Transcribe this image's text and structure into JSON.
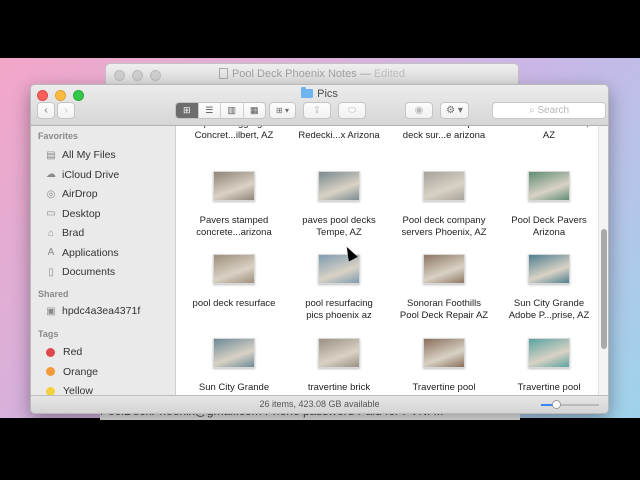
{
  "background_window": {
    "title": "Pool Deck Phoenix Notes",
    "status": "Edited",
    "bottom_text": "PoolDeckPhoenix@gmail.com Phone password Paid for PVNP..."
  },
  "window": {
    "title": "Pics",
    "search_placeholder": "Search",
    "status_text": "26 items, 423.08 GB available",
    "icon_size_level": 0.25
  },
  "toolbar": {
    "back": "‹",
    "forward": "›",
    "view_modes": [
      "⊞",
      "☰",
      "▥",
      "▦"
    ],
    "arrange": "⊞ ▾",
    "share": "⇪",
    "tag": "⬭",
    "quick_look": "◉",
    "action": "⚙ ▾"
  },
  "sidebar": {
    "favorites_header": "Favorites",
    "favorites": [
      {
        "label": "All My Files",
        "icon": "all-files-icon",
        "glyph": "▤"
      },
      {
        "label": "iCloud Drive",
        "icon": "cloud-icon",
        "glyph": "☁"
      },
      {
        "label": "AirDrop",
        "icon": "airdrop-icon",
        "glyph": "◎"
      },
      {
        "label": "Desktop",
        "icon": "desktop-icon",
        "glyph": "▭"
      },
      {
        "label": "Brad",
        "icon": "home-icon",
        "glyph": "⌂"
      },
      {
        "label": "Applications",
        "icon": "applications-icon",
        "glyph": "A"
      },
      {
        "label": "Documents",
        "icon": "documents-icon",
        "glyph": "▯"
      }
    ],
    "shared_header": "Shared",
    "shared": [
      {
        "label": "hpdc4a3ea4371f",
        "icon": "computer-icon",
        "glyph": "▣"
      }
    ],
    "tags_header": "Tags",
    "tags": [
      {
        "label": "Red",
        "color": "#e0474c"
      },
      {
        "label": "Orange",
        "color": "#f29a37"
      },
      {
        "label": "Yellow",
        "color": "#f3d13c"
      }
    ]
  },
  "files": [
    {
      "line1": "Exposed Aggregate",
      "line2": "Concret...ilbert, AZ",
      "thumb": ""
    },
    {
      "line1": "Lace Pool",
      "line2": "Redecki...x Arizona",
      "thumb": ""
    },
    {
      "line1": "Marbella stone pool",
      "line2": "deck sur...e arizona",
      "thumb": ""
    },
    {
      "line1": "Pavers Scottsdale,",
      "line2": "AZ",
      "thumb": ""
    },
    {
      "line1": "Pavers stamped",
      "line2": "concrete...arizona",
      "thumb": "#8f8578"
    },
    {
      "line1": "paves pool decks",
      "line2": "Tempe, AZ",
      "thumb": "#7a8a90"
    },
    {
      "line1": "Pool deck company",
      "line2": "servers Phoenix, AZ",
      "thumb": "#a7a39b"
    },
    {
      "line1": "Pool Deck Pavers",
      "line2": "Arizona",
      "thumb": "#5f8d74"
    },
    {
      "line1": "pool deck resurface",
      "line2": "",
      "thumb": "#9e8e7a"
    },
    {
      "line1": "pool resurfacing",
      "line2": "pics phoenix az",
      "thumb": "#7f9bb0"
    },
    {
      "line1": "Sonoran Foothills",
      "line2": "Pool Deck Repair AZ",
      "thumb": "#8e7763"
    },
    {
      "line1": "Sun City Grande",
      "line2": "Adobe P...prise, AZ",
      "thumb": "#4f7f8f"
    },
    {
      "line1": "Sun City Grande",
      "line2": "",
      "thumb": "#6c8a96"
    },
    {
      "line1": "travertine brick",
      "line2": "",
      "thumb": "#9a9184"
    },
    {
      "line1": "Travertine pool",
      "line2": "",
      "thumb": "#8a6f5c"
    },
    {
      "line1": "Travertine pool",
      "line2": "",
      "thumb": "#5aa3a0"
    }
  ]
}
